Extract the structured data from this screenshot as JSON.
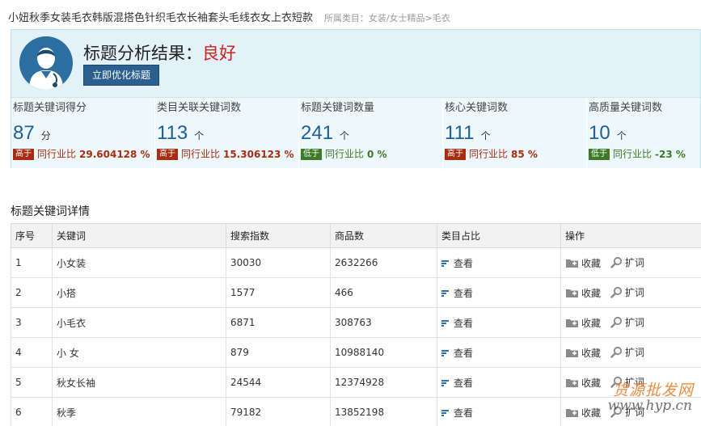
{
  "header": {
    "title": "小妞秋季女装毛衣韩版混搭色针织毛衣长袖套头毛线衣女上衣短款",
    "category": "所属类目：女装/女士精品>毛衣"
  },
  "analysis": {
    "heading": "标题分析结果：",
    "verdict": "良好",
    "optimize_button": "立即优化标题",
    "verdict_color": "#d02020"
  },
  "stats": [
    {
      "label": "标题关键词得分",
      "value": "87",
      "unit": "分",
      "badge": "高于",
      "compare_label": "同行业比",
      "percent": "29.604128 %",
      "trend": "up"
    },
    {
      "label": "类目关联关键词数",
      "value": "113",
      "unit": "个",
      "badge": "高于",
      "compare_label": "同行业比",
      "percent": "15.306123 %",
      "trend": "up"
    },
    {
      "label": "标题关键词数量",
      "value": "241",
      "unit": "个",
      "badge": "低于",
      "compare_label": "同行业比",
      "percent": "0 %",
      "trend": "down"
    },
    {
      "label": "核心关键词数",
      "value": "111",
      "unit": "个",
      "badge": "高于",
      "compare_label": "同行业比",
      "percent": "85 %",
      "trend": "up"
    },
    {
      "label": "高质量关键词数",
      "value": "10",
      "unit": "个",
      "badge": "低于",
      "compare_label": "同行业比",
      "percent": "-23 %",
      "trend": "down"
    }
  ],
  "details": {
    "title": "标题关键词详情",
    "columns": [
      "序号",
      "关键词",
      "搜索指数",
      "商品数",
      "类目占比",
      "操作"
    ],
    "view_label": "查看",
    "fav_label": "收藏",
    "expand_label": "扩词",
    "rows": [
      {
        "index": "1",
        "keyword": "小女装",
        "search": "30030",
        "products": "2632266"
      },
      {
        "index": "2",
        "keyword": "小搭",
        "search": "1577",
        "products": "466"
      },
      {
        "index": "3",
        "keyword": "小毛衣",
        "search": "6871",
        "products": "308763"
      },
      {
        "index": "4",
        "keyword": "小 女",
        "search": "879",
        "products": "10988140"
      },
      {
        "index": "5",
        "keyword": "秋女长袖",
        "search": "24544",
        "products": "12374928"
      },
      {
        "index": "6",
        "keyword": "秋季",
        "search": "79182",
        "products": "13852198"
      }
    ]
  },
  "watermark": {
    "line1": "货源批发网",
    "line2": "www.hyp.cn"
  },
  "colors": {
    "accent": "#1f5f97",
    "badge_high": "#a62d12",
    "badge_low": "#3d7a28",
    "button": "#2a5f8e"
  },
  "icons": {
    "avatar": "doctor-avatar-icon",
    "view": "bar-chart-icon",
    "fav": "folder-plus-icon",
    "expand": "magnifier-icon"
  }
}
